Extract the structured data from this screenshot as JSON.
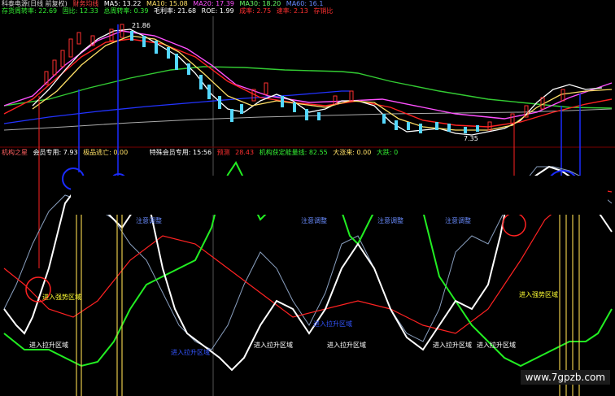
{
  "top_header": {
    "title": "科泰电源(日线 前复权)",
    "indicator": "财务均线",
    "ma5": "MA5: 13.22",
    "ma10": "MA10: 15.08",
    "ma20": "MA20: 17.39",
    "ma30": "MA30: 18.20",
    "ma60": "MA60: 16.1"
  },
  "second_header": {
    "inventory_turnover": "存货周转率: 22.69",
    "profit_ratio": "固比: 12.33",
    "total_asset_turnover": "总周转率: 0.39",
    "gross_margin": "毛利率: 21.68",
    "roe": "ROE: 1.99",
    "growth": "成率: 2.75",
    "speed": "速率: 2.13",
    "extra": "存销比"
  },
  "price_labels": {
    "high": "21.86",
    "low": "7.35"
  },
  "bottom_header": {
    "title": "机构之星",
    "member_only": "会员专用: 7.93",
    "bottom_escape": "极品逃亡: 0.00",
    "special_member": "特殊会员专用: 15:56",
    "warn_label": "预测",
    "warn_value": "28.43",
    "institution_volume": "机构获定能量线: 82.55",
    "big_rise": "大涨来: 0.00",
    "big_fall": "大跌: 0"
  },
  "annotations": {
    "caution1": "注意调整",
    "caution2": "注意调整",
    "caution3": "注意调整",
    "caution4": "注意调整",
    "strong_left": "进入强势区域",
    "strong_right": "进入强势区域",
    "pullup1": "进入拉升区域",
    "pullup2": "进入拉升区域",
    "pullup3": "进入拉升区域",
    "pullup_bottom": "进入拉升区域",
    "pullup_right": "进入拉升区域",
    "blue1": "进入拉升区域",
    "blue2": "进入拉升区域"
  },
  "watermark": "www.7gpzb.com",
  "colors": {
    "up_candle": "#ff3030",
    "down_candle": "#54d8ff",
    "ma5": "#ffffff",
    "ma10": "#ffe066",
    "ma20": "#ff50ff",
    "ma30": "#33cc33",
    "ma60": "#2233ff",
    "white_line": "#ffffff",
    "red_line": "#ff2222",
    "green_line": "#22ee22",
    "gray_line": "#8aa0c0",
    "yellow_bar": "#e6c94a",
    "blue_vline": "#1a2cff"
  }
}
